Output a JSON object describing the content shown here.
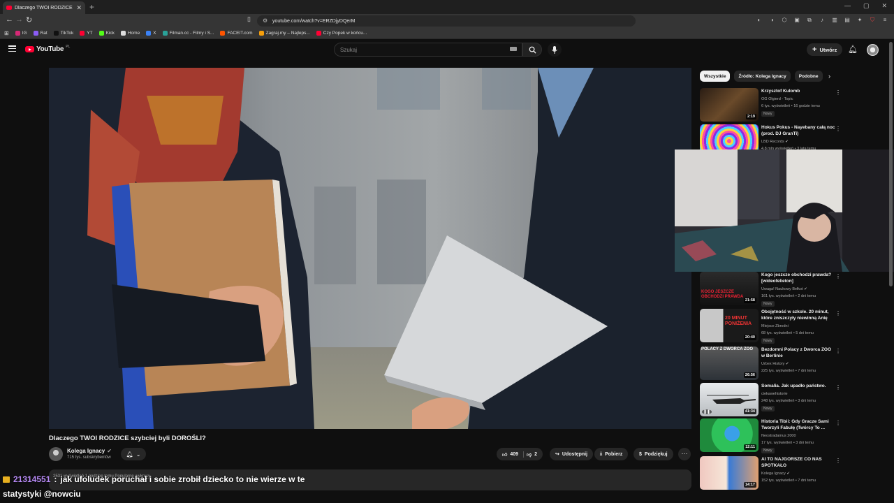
{
  "browser": {
    "tab_title": "Dlaczego TWOI RODZICE szy...",
    "new_tab": "+",
    "url": "youtube.com/watch?v=ERZDjyDQerM",
    "bookmarks": [
      {
        "label": "IG",
        "color": "#d62976"
      },
      {
        "label": "Rat",
        "color": "#8b5cf6"
      },
      {
        "label": "TikTok",
        "color": "#111111"
      },
      {
        "label": "YT",
        "color": "#ff0033"
      },
      {
        "label": "Kick",
        "color": "#53fc18"
      },
      {
        "label": "Home",
        "color": "#dddddd"
      },
      {
        "label": "X",
        "color": "#3b82f6"
      },
      {
        "label": "Filman.cc - Filmy i S...",
        "color": "#2aa198"
      },
      {
        "label": "FACEIT.com",
        "color": "#ff5500"
      },
      {
        "label": "Zagraj.my – Najleps...",
        "color": "#f59e0b"
      },
      {
        "label": "Czy Popek w końcu...",
        "color": "#ff0033"
      }
    ]
  },
  "header": {
    "logo": "YouTube",
    "country": "PL",
    "search_placeholder": "Szukaj",
    "create_label": "Utwórz"
  },
  "video": {
    "title": "Dlaczego TWOI RODZICE szybciej byli DOROŚLI?",
    "channel": "Kolega Ignacy",
    "verified": "✔",
    "subscribers": "715 tys. subskrybentów",
    "likes": "409",
    "dislikes": "2",
    "share": "Udostępnij",
    "download": "Pobierz",
    "thanks": "Podziękuj",
    "desc_line": "2531 wyświetleń  1 godzinę temu  Popularne wykresy"
  },
  "sidebar": {
    "chips": [
      "Wszystkie",
      "Źródło: Kolega Ignacy",
      "Podobne"
    ],
    "items": [
      {
        "title": "Krzysztof Kulomb",
        "channel": "OG Olgierd - Topic",
        "meta": "6 tys. wyświetleń • 16 godzin temu",
        "badge": "Nowy",
        "duration": "2:19"
      },
      {
        "title": "Hokus Pokus - Nayebany całą noc (prod. DJ GranTi)",
        "channel": "LBD Records ✔",
        "meta": "4,8 mln wyświetleń • 3 lata temu",
        "badge": "",
        "duration": ""
      },
      {
        "title": "Kogo jeszcze obchodzi prawda? [wideofelieton]",
        "channel": "Uwaga! Naukowy Bełkot ✔",
        "meta": "161 tys. wyświetleń • 2 dni temu",
        "badge": "Nowy",
        "duration": "21:58"
      },
      {
        "title": "Obojętność w szkole. 20 minut, które zniszczyły niewinną Anię",
        "channel": "Miejsce Zbrodni",
        "meta": "68 tys. wyświetleń • 5 dni temu",
        "badge": "Nowy",
        "duration": "20:40"
      },
      {
        "title": "Bezdomni Polacy z Dworca ZOO w Berlinie",
        "channel": "Urbex History ✔",
        "meta": "225 tys. wyświetleń • 7 dni temu",
        "badge": "",
        "duration": "26:56"
      },
      {
        "title": "Somalia. Jak upadło państwo.",
        "channel": "ciekawehistorie",
        "meta": "248 tys. wyświetleń • 3 dni temu",
        "badge": "Nowy",
        "duration": "41:34"
      },
      {
        "title": "Historia Tibii: Gdy Gracze Sami Tworzyli Fabułę (Twórcy To ...",
        "channel": "Neostradamus 2000",
        "meta": "17 tys. wyświetleń • 3 dni temu",
        "badge": "Nowy",
        "duration": "12:11"
      },
      {
        "title": "AI TO NAJGORSZE CO NAS SPOTKAŁO",
        "channel": "Kolega Ignacy ✔",
        "meta": "152 tys. wyświetleń • 7 dni temu",
        "badge": "",
        "duration": "14:17"
      }
    ],
    "thumb_texts": {
      "item3": "KOGO JESZCZE OBCHODZI PRAWDA",
      "item4": "20 MINUT PONIŻENIA",
      "item5": "POLACY Z DWORCA ZOO"
    }
  },
  "chat": {
    "user": "21314551",
    "message": "jak ufoludek poruchał i sobie zrobił dziecko to nie wierze w te",
    "line2": "statystyki @nowciu"
  }
}
